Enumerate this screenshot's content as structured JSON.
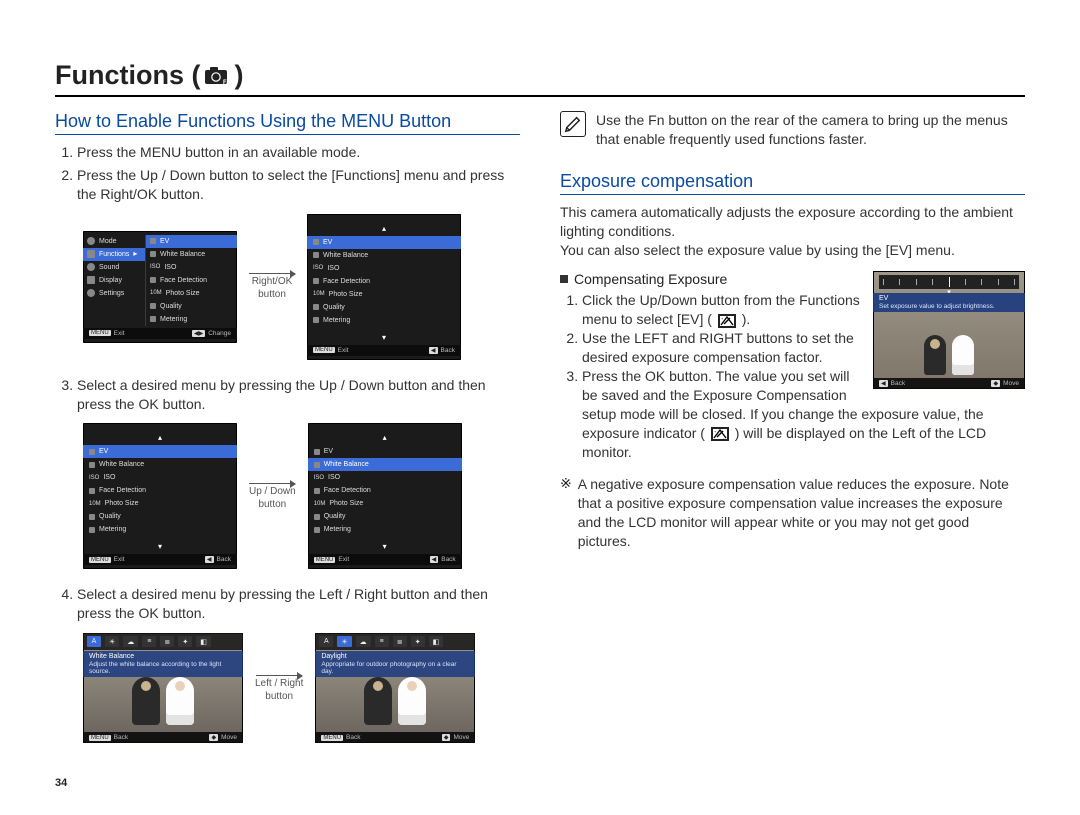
{
  "page_title_prefix": "Functions (",
  "page_title_suffix": " )",
  "page_number": "34",
  "left": {
    "section_title": "How to Enable Functions Using the MENU Button",
    "steps": {
      "s1": "Press the MENU button in an available mode.",
      "s2": "Press the Up / Down button to select the [Functions] menu and press the Right/OK button.",
      "s3": "Select a desired menu by pressing the Up / Down button and then press the OK button.",
      "s4": "Select a desired menu by pressing the Left / Right button and then press the OK button."
    },
    "arrows": {
      "a1_l1": "Right/OK",
      "a1_l2": "button",
      "a2_l1": "Up / Down",
      "a2_l2": "button",
      "a3_l1": "Left / Right",
      "a3_l2": "button"
    },
    "panel_main": {
      "left_tabs": [
        "Mode",
        "Functions",
        "Sound",
        "Display",
        "Settings"
      ],
      "right_items": [
        "EV",
        "White Balance",
        "ISO",
        "Face Detection",
        "Photo Size",
        "Quality",
        "Metering"
      ],
      "footer_left": "Exit",
      "footer_right": "Change",
      "footer_left_key": "MENU"
    },
    "panel_sub": {
      "items": [
        "EV",
        "White Balance",
        "ISO",
        "Face Detection",
        "Photo Size",
        "Quality",
        "Metering"
      ],
      "footer_left": "Exit",
      "footer_right": "Back",
      "footer_left_key": "MENU"
    },
    "photo_panel1": {
      "title": "White Balance",
      "subtitle": "Adjust the white balance according to the light source.",
      "footer_left": "Back",
      "footer_right": "Move",
      "footer_left_key": "MENU"
    },
    "photo_panel2": {
      "title": "Daylight",
      "subtitle": "Appropriate for outdoor photography on a clear day.",
      "footer_left": "Back",
      "footer_right": "Move",
      "footer_left_key": "MENU"
    }
  },
  "right": {
    "tip": "Use the Fn button on the rear of the camera to bring up the menus that enable frequently used functions faster.",
    "section_title": "Exposure compensation",
    "para1": "This camera automatically adjusts the exposure according to the ambient lighting conditions.",
    "para2": "You can also select the exposure value by using the [EV] menu.",
    "sub_heading": "Compensating Exposure",
    "steps": {
      "s1a": "Click the Up/Down button from the Functions menu to select [EV] (",
      "s1b": " ).",
      "s2": "Use the LEFT and RIGHT buttons to set the desired exposure compensation factor.",
      "s3a": "Press the OK button. The value you set will be saved and the Exposure Compensation setup mode will be closed. If you change the exposure value, the exposure indicator ( ",
      "s3b": " ) will be displayed on the Left of the LCD monitor."
    },
    "note_mark": "※",
    "note": "A negative exposure compensation value reduces the exposure. Note that a positive exposure compensation value increases the exposure and the LCD monitor will appear white or you may not get good pictures.",
    "ev_panel": {
      "title": "EV",
      "subtitle": "Set exposure value to adjust brightness.",
      "footer_left": "Back",
      "footer_right": "Move",
      "footer_left_key": "◀"
    }
  }
}
